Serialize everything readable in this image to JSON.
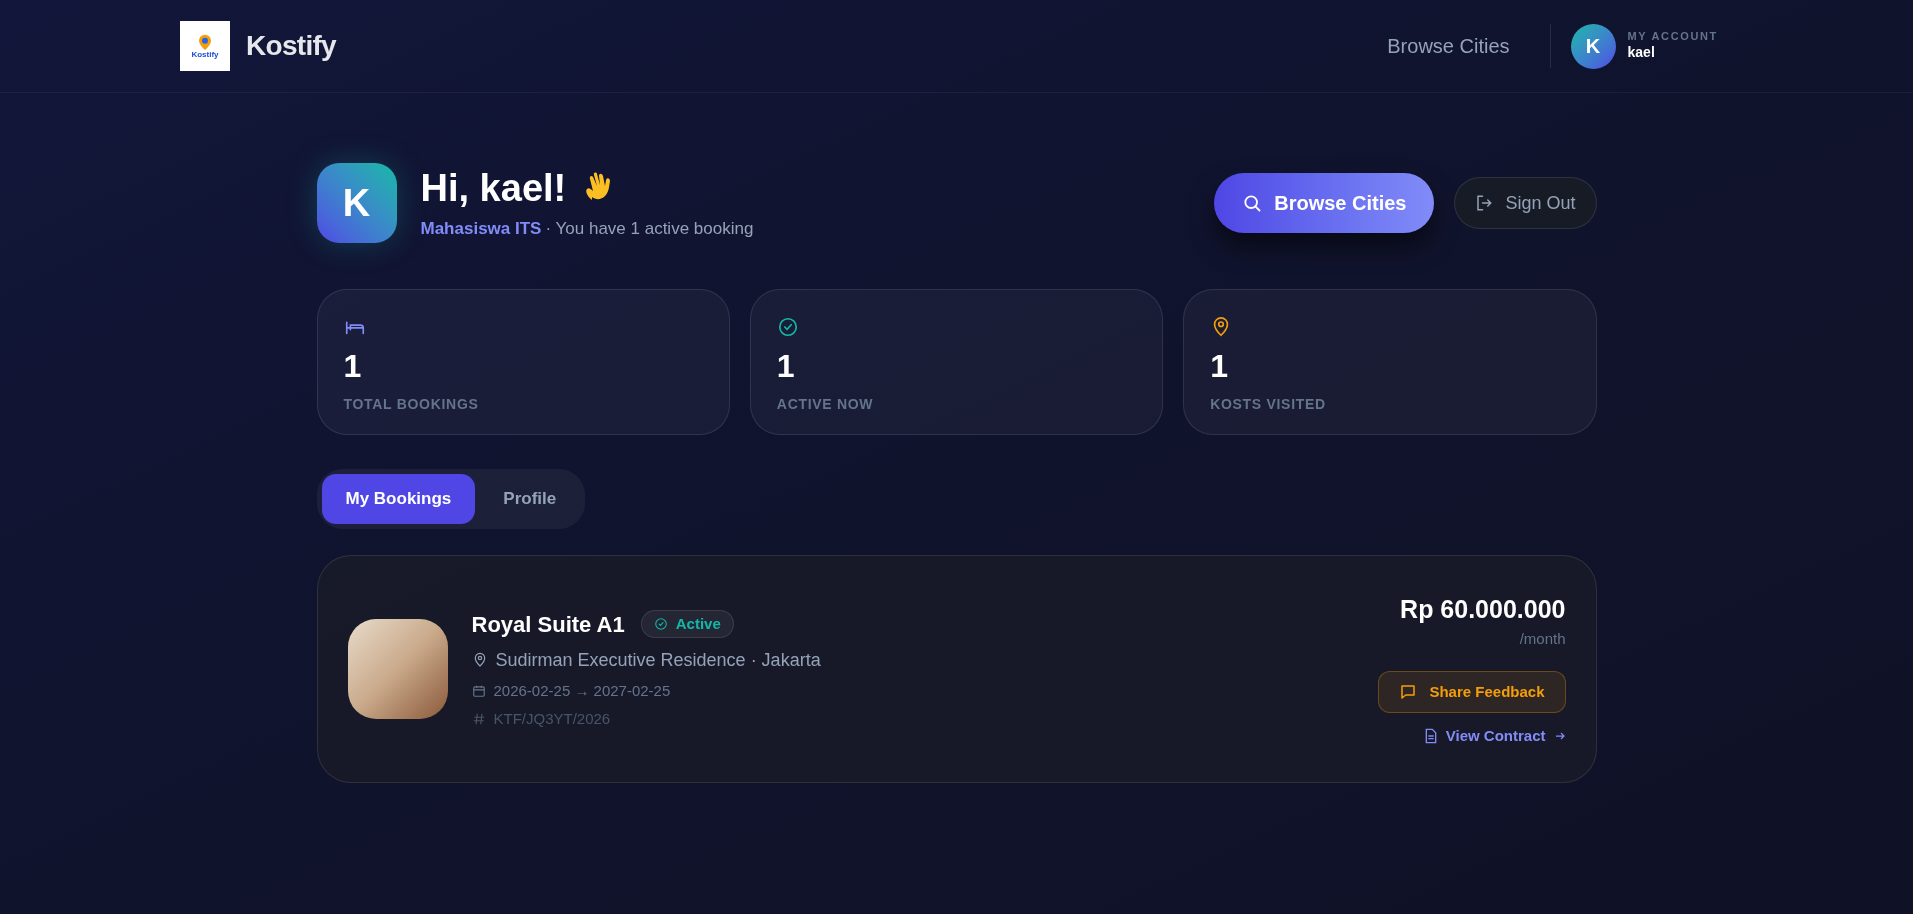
{
  "header": {
    "logo_text": "Kostify",
    "brand": "Kostify",
    "nav_link": "Browse Cities",
    "account": {
      "initial": "K",
      "label": "MY ACCOUNT",
      "name": "kael"
    }
  },
  "greeting": {
    "initial": "K",
    "title": "Hi, kael!",
    "role": "Mahasiswa ITS",
    "summary": "· You have 1 active booking"
  },
  "actions": [
    {
      "kind": "primary",
      "label": "Browse Cities"
    },
    {
      "kind": "secondary",
      "label": "Sign Out"
    }
  ],
  "stats": [
    {
      "kind": "bed",
      "value": "1",
      "label": "TOTAL BOOKINGS",
      "color": "#818cf8"
    },
    {
      "kind": "check",
      "value": "1",
      "label": "ACTIVE NOW",
      "color": "#14b8a6"
    },
    {
      "kind": "pin",
      "value": "1",
      "label": "KOSTS VISITED",
      "color": "#f59e0b"
    }
  ],
  "tabs": [
    {
      "label": "My Bookings",
      "selected": true
    },
    {
      "label": "Profile",
      "selected": false
    }
  ],
  "bookings": [
    {
      "room": "Royal Suite A1",
      "status": "Active",
      "location": "Sudirman Executive Residence · Jakarta",
      "dates": "2026-02-25 → 2027-02-25",
      "code": "KTF/JQ3YT/2026",
      "price": "Rp 60.000.000",
      "period": "/month",
      "feedback": "Share Feedback",
      "contract": "View Contract"
    }
  ]
}
